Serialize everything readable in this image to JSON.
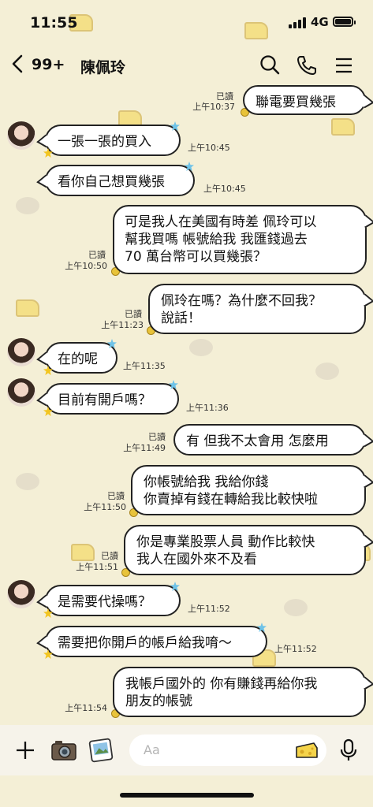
{
  "status_bar": {
    "time": "11:55",
    "network": "4G",
    "signal_icon": "signal-bars-icon",
    "battery_icon": "battery-icon"
  },
  "header": {
    "back_icon": "chevron-left-icon",
    "unread_count": "99+",
    "contact_name": "陳佩玲",
    "search_icon": "search-icon",
    "call_icon": "phone-icon",
    "menu_icon": "hamburger-menu-icon"
  },
  "messages": [
    {
      "from": "me",
      "text": "聯電要買幾張",
      "read": "已讀",
      "time": "上午10:37"
    },
    {
      "from": "other",
      "text": "一張一張的買入",
      "time": "上午10:45"
    },
    {
      "from": "other",
      "text": "看你自己想買幾張",
      "time": "上午10:45"
    },
    {
      "from": "me",
      "line1": "可是我人在美國有時差 佩玲可以",
      "line2": "幫我買嗎 帳號給我 我匯錢過去",
      "line3": "70 萬台幣可以買幾張？",
      "read": "已讀",
      "time": "上午10:50"
    },
    {
      "from": "me",
      "line1": "佩玲在嗎？為什麼不回我？",
      "line2": "說話！",
      "read": "已讀",
      "time": "上午11:23"
    },
    {
      "from": "other",
      "text": "在的呢",
      "time": "上午11:35"
    },
    {
      "from": "other",
      "text": "目前有開戶嗎？",
      "time": "上午11:36"
    },
    {
      "from": "me",
      "text": "有 但我不太會用 怎麼用",
      "read": "已讀",
      "time": "上午11:49"
    },
    {
      "from": "me",
      "line1": "你帳號給我 我給你錢",
      "line2": "你賣掉有錢在轉給我比較快啦",
      "read": "已讀",
      "time": "上午11:50"
    },
    {
      "from": "me",
      "line1": "你是專業股票人員 動作比較快",
      "line2": "我人在國外來不及看",
      "read": "已讀",
      "time": "上午11:51"
    },
    {
      "from": "other",
      "text": "是需要代操嗎？",
      "time": "上午11:52"
    },
    {
      "from": "other",
      "text": "需要把你開戶的帳戶給我唷～",
      "time": "上午11:52"
    },
    {
      "from": "me",
      "line1": "我帳戶國外的 你有賺錢再給你我",
      "line2": "朋友的帳號",
      "time": "上午11:54"
    }
  ],
  "input_bar": {
    "add_icon": "plus-icon",
    "camera_icon": "camera-icon",
    "gallery_icon": "photo-icon",
    "placeholder": "Aa",
    "sticker_icon": "cheese-sticker-icon",
    "mic_icon": "microphone-icon"
  },
  "colors": {
    "background": "#f4efd6",
    "bubble": "#ffffff",
    "bubble_border": "#222222",
    "star": "#6fc3e8"
  }
}
